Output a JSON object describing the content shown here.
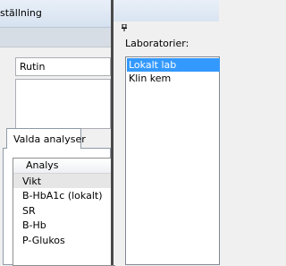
{
  "window": {
    "title": "ställning"
  },
  "form": {
    "routine_value": "Rutin"
  },
  "tabs": [
    {
      "label": "Valda analyser"
    }
  ],
  "analyses": {
    "column_header": "Analys",
    "rows": [
      "Vikt",
      "B-HbA1c (lokalt)",
      "SR",
      "B-Hb",
      "P-Glukos"
    ],
    "selected_index": 0
  },
  "laboratories": {
    "label": "Laboratorier:",
    "items": [
      "Lokalt lab",
      "Klin kem"
    ],
    "selected_index": 0
  },
  "icons": {
    "pin": "pin-icon"
  },
  "colors": {
    "selection": "#3399ff",
    "divider": "#4a4a4a"
  }
}
